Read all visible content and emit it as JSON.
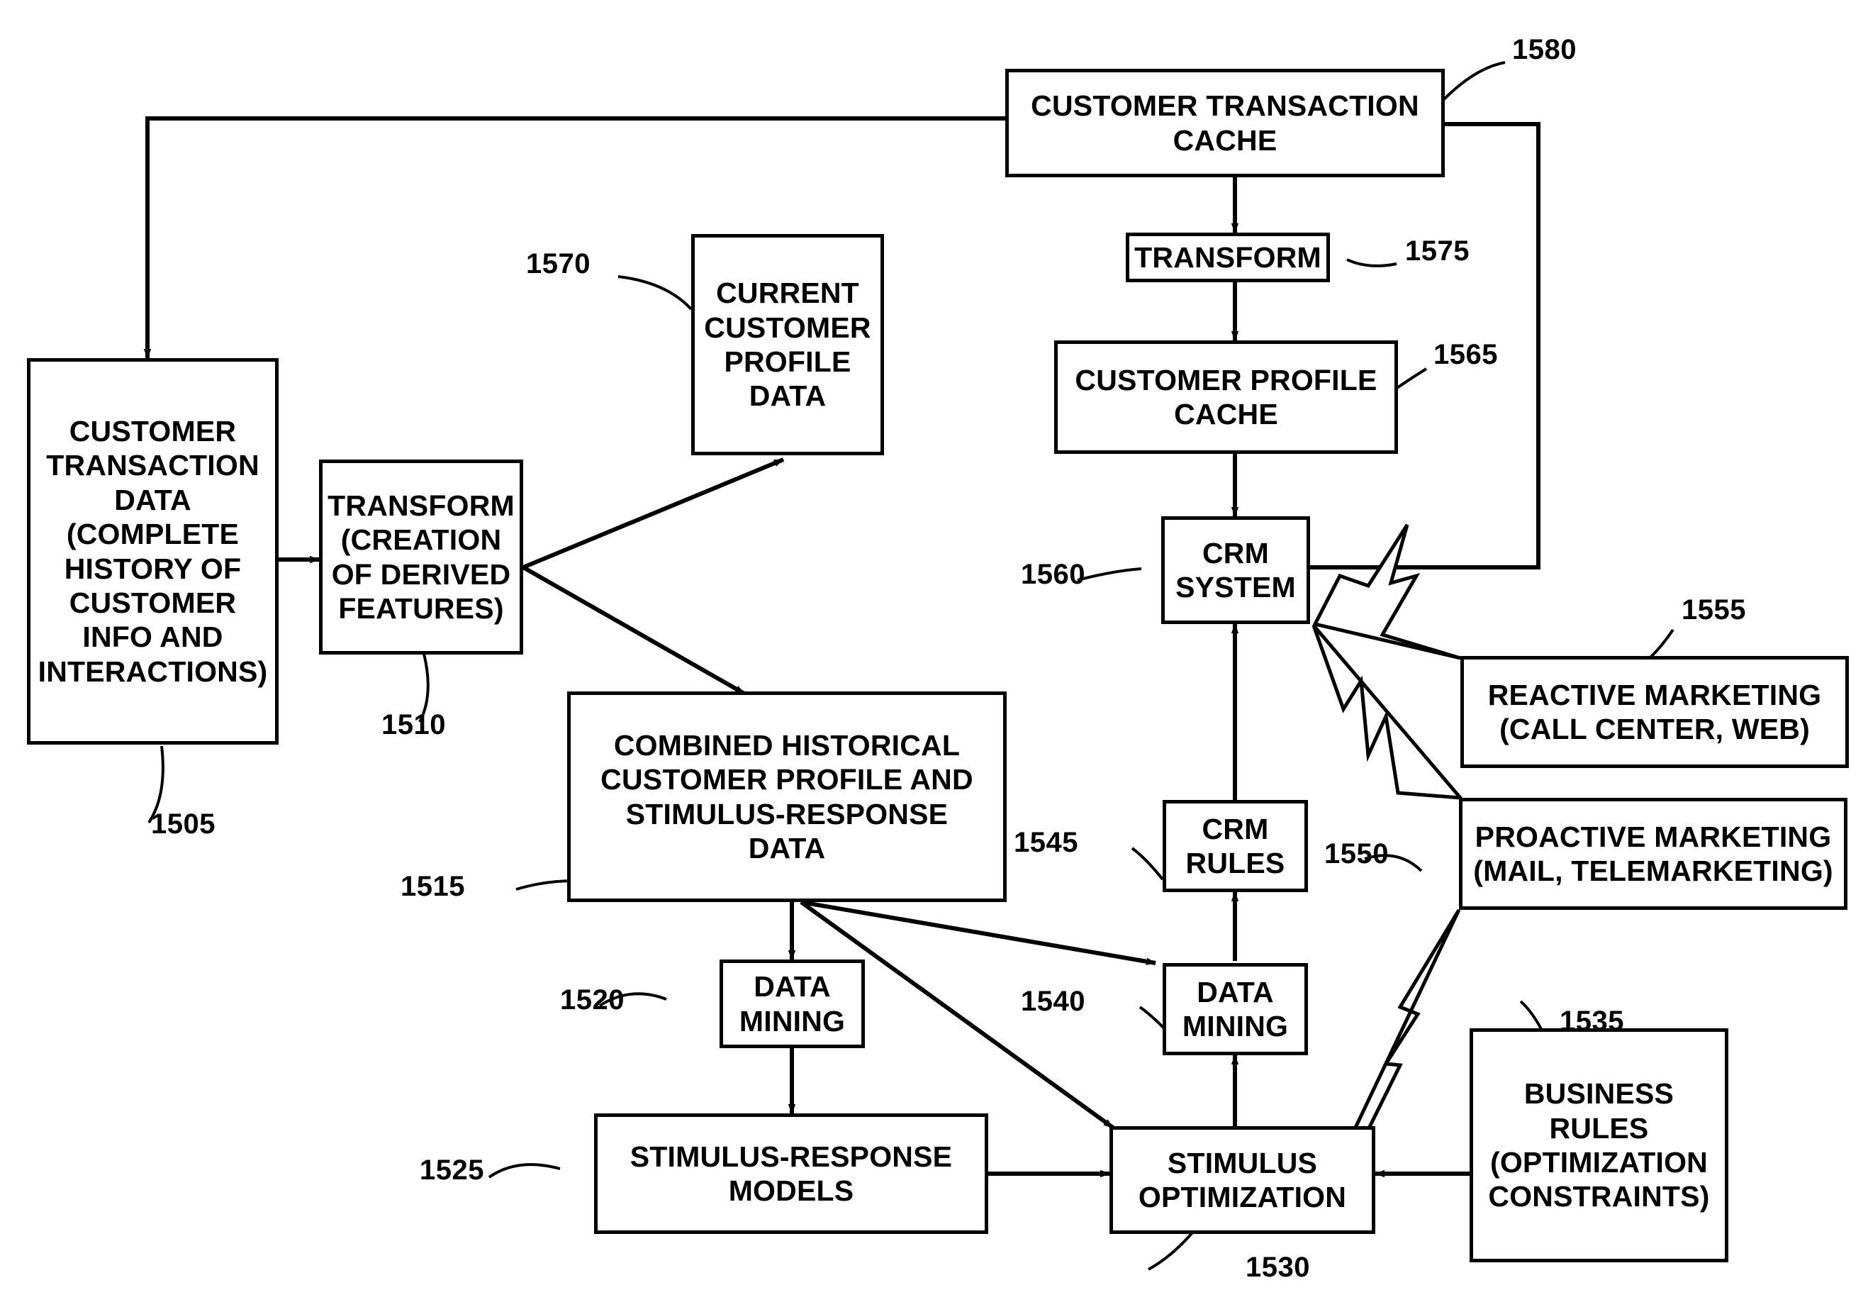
{
  "figure": {
    "kind": "patent-flow-diagram",
    "stroke_color": "#000000",
    "background_color": "#ffffff"
  },
  "nodes": {
    "customer_transaction_data": {
      "label": "CUSTOMER TRANSACTION DATA (COMPLETE HISTORY OF CUSTOMER INFO AND INTERACTIONS)",
      "ref": "1505"
    },
    "transform_derived": {
      "label": "TRANSFORM (CREATION OF DERIVED FEATURES)",
      "ref": "1510"
    },
    "current_customer_profile_data": {
      "label": "CURRENT CUSTOMER PROFILE DATA",
      "ref": "1570"
    },
    "combined_historical": {
      "label": "COMBINED HISTORICAL CUSTOMER PROFILE AND STIMULUS-RESPONSE DATA",
      "ref": "1515"
    },
    "data_mining_left": {
      "label": "DATA MINING",
      "ref": "1520"
    },
    "stimulus_response_models": {
      "label": "STIMULUS-RESPONSE MODELS",
      "ref": "1525"
    },
    "stimulus_optimization": {
      "label": "STIMULUS OPTIMIZATION",
      "ref": "1530"
    },
    "business_rules": {
      "label": "BUSINESS RULES (OPTIMIZATION CONSTRAINTS)",
      "ref": "1535"
    },
    "data_mining_right": {
      "label": "DATA MINING",
      "ref": "1540"
    },
    "crm_rules": {
      "label": "CRM RULES",
      "ref": "1545"
    },
    "proactive_marketing": {
      "label": "PROACTIVE MARKETING (MAIL, TELEMARKETING)",
      "ref": "1550"
    },
    "reactive_marketing": {
      "label": "REACTIVE MARKETING (CALL CENTER, WEB)",
      "ref": "1555"
    },
    "crm_system": {
      "label": "CRM SYSTEM",
      "ref": "1560"
    },
    "customer_profile_cache": {
      "label": "CUSTOMER PROFILE CACHE",
      "ref": "1565"
    },
    "transform_cache": {
      "label": "TRANSFORM",
      "ref": "1575"
    },
    "customer_transaction_cache": {
      "label": "CUSTOMER TRANSACTION CACHE",
      "ref": "1580"
    }
  },
  "node_lines": {
    "customer_transaction_data": [
      "CUSTOMER",
      "TRANSACTION",
      "DATA",
      "(COMPLETE",
      "HISTORY OF",
      "CUSTOMER",
      "INFO AND",
      "INTERACTIONS)"
    ],
    "transform_derived": [
      "TRANSFORM",
      "(CREATION",
      "OF DERIVED",
      "FEATURES)"
    ],
    "current_customer_profile_data": [
      "CURRENT",
      "CUSTOMER",
      "PROFILE",
      "DATA"
    ],
    "combined_historical": [
      "COMBINED HISTORICAL",
      "CUSTOMER PROFILE AND",
      "STIMULUS-RESPONSE",
      "DATA"
    ],
    "data_mining_left": [
      "DATA",
      "MINING"
    ],
    "stimulus_response_models": [
      "STIMULUS-RESPONSE",
      "MODELS"
    ],
    "stimulus_optimization": [
      "STIMULUS",
      "OPTIMIZATION"
    ],
    "business_rules": [
      "BUSINESS",
      "RULES",
      "(OPTIMIZATION",
      "CONSTRAINTS)"
    ],
    "data_mining_right": [
      "DATA",
      "MINING"
    ],
    "crm_rules": [
      "CRM",
      "RULES"
    ],
    "proactive_marketing": [
      "PROACTIVE MARKETING",
      "(MAIL, TELEMARKETING)"
    ],
    "reactive_marketing": [
      "REACTIVE MARKETING",
      "(CALL CENTER, WEB)"
    ],
    "crm_system": [
      "CRM",
      "SYSTEM"
    ],
    "customer_profile_cache": [
      "CUSTOMER PROFILE",
      "CACHE"
    ],
    "transform_cache": [
      "TRANSFORM"
    ],
    "customer_transaction_cache": [
      "CUSTOMER TRANSACTION",
      "CACHE"
    ]
  },
  "refs": {
    "r1505": "1505",
    "r1510": "1510",
    "r1515": "1515",
    "r1520": "1520",
    "r1525": "1525",
    "r1530": "1530",
    "r1535": "1535",
    "r1540": "1540",
    "r1545": "1545",
    "r1550": "1550",
    "r1555": "1555",
    "r1560": "1560",
    "r1565": "1565",
    "r1570": "1570",
    "r1575": "1575",
    "r1580": "1580"
  },
  "chart_data": {
    "type": "table",
    "title": "CRM stimulus optimization flow diagram",
    "nodes": [
      {
        "ref": "1505",
        "label": "CUSTOMER TRANSACTION DATA (COMPLETE HISTORY OF CUSTOMER INFO AND INTERACTIONS)"
      },
      {
        "ref": "1510",
        "label": "TRANSFORM (CREATION OF DERIVED FEATURES)"
      },
      {
        "ref": "1515",
        "label": "COMBINED HISTORICAL CUSTOMER PROFILE AND STIMULUS-RESPONSE DATA"
      },
      {
        "ref": "1520",
        "label": "DATA MINING"
      },
      {
        "ref": "1525",
        "label": "STIMULUS-RESPONSE MODELS"
      },
      {
        "ref": "1530",
        "label": "STIMULUS OPTIMIZATION"
      },
      {
        "ref": "1535",
        "label": "BUSINESS RULES (OPTIMIZATION CONSTRAINTS)"
      },
      {
        "ref": "1540",
        "label": "DATA MINING"
      },
      {
        "ref": "1545",
        "label": "CRM RULES"
      },
      {
        "ref": "1550",
        "label": "PROACTIVE MARKETING (MAIL, TELEMARKETING)"
      },
      {
        "ref": "1555",
        "label": "REACTIVE MARKETING (CALL CENTER, WEB)"
      },
      {
        "ref": "1560",
        "label": "CRM SYSTEM"
      },
      {
        "ref": "1565",
        "label": "CUSTOMER PROFILE CACHE"
      },
      {
        "ref": "1570",
        "label": "CURRENT CUSTOMER PROFILE DATA"
      },
      {
        "ref": "1575",
        "label": "TRANSFORM"
      },
      {
        "ref": "1580",
        "label": "CUSTOMER TRANSACTION CACHE"
      }
    ],
    "edges": [
      {
        "from": "1580",
        "to": "1505",
        "style": "orthogonal-arrow"
      },
      {
        "from": "1505",
        "to": "1510",
        "style": "arrow"
      },
      {
        "from": "1510",
        "to": "1570",
        "style": "arrow"
      },
      {
        "from": "1510",
        "to": "1515",
        "style": "arrow"
      },
      {
        "from": "1515",
        "to": "1520",
        "style": "arrow"
      },
      {
        "from": "1520",
        "to": "1525",
        "style": "arrow"
      },
      {
        "from": "1525",
        "to": "1530",
        "style": "arrow"
      },
      {
        "from": "1515",
        "to": "1540",
        "style": "arrow"
      },
      {
        "from": "1515",
        "to": "1530",
        "style": "arrow"
      },
      {
        "from": "1530",
        "to": "1540",
        "style": "arrow"
      },
      {
        "from": "1540",
        "to": "1545",
        "style": "arrow"
      },
      {
        "from": "1545",
        "to": "1560",
        "style": "arrow"
      },
      {
        "from": "1535",
        "to": "1530",
        "style": "arrow"
      },
      {
        "from": "1580",
        "to": "1575",
        "style": "arrow"
      },
      {
        "from": "1575",
        "to": "1565",
        "style": "arrow"
      },
      {
        "from": "1565",
        "to": "1560",
        "style": "arrow"
      },
      {
        "from": "1560",
        "to": "1580",
        "style": "orthogonal-arrow"
      },
      {
        "from": "1560",
        "to": "1555",
        "style": "lightning"
      },
      {
        "from": "1560",
        "to": "1550",
        "style": "lightning"
      },
      {
        "from": "1550",
        "to": "1530",
        "style": "lightning"
      }
    ]
  }
}
